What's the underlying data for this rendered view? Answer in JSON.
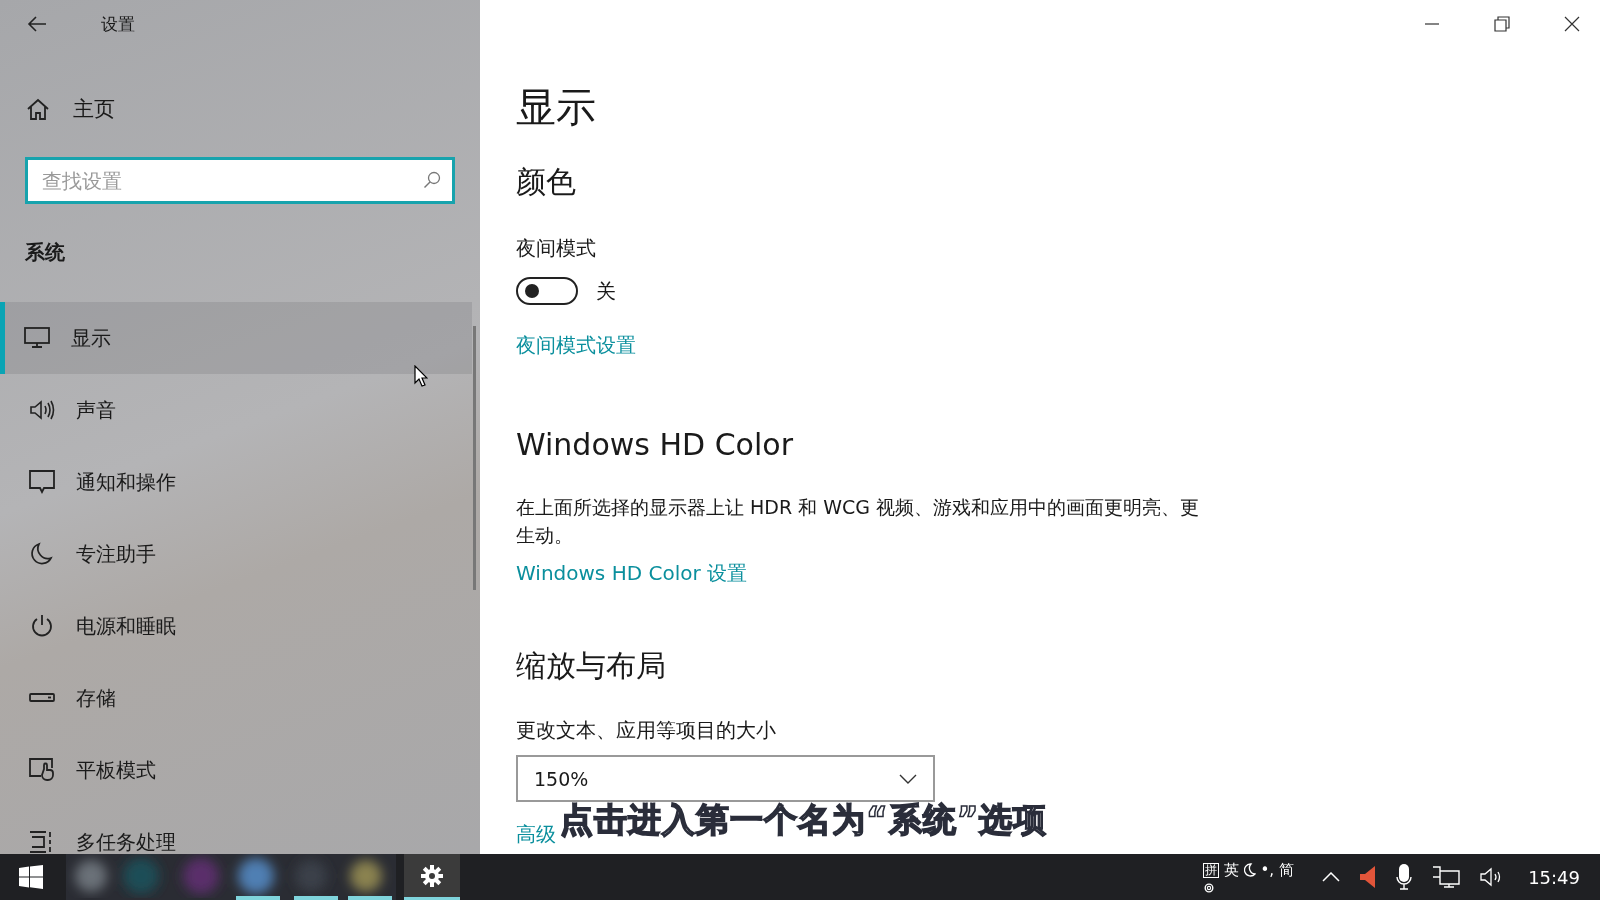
{
  "window": {
    "title": "设置"
  },
  "sidebar": {
    "home": "主页",
    "search": {
      "placeholder": "查找设置"
    },
    "section": "系统",
    "items": [
      {
        "label": "显示",
        "selected": true
      },
      {
        "label": "声音",
        "selected": false
      },
      {
        "label": "通知和操作",
        "selected": false
      },
      {
        "label": "专注助手",
        "selected": false
      },
      {
        "label": "电源和睡眠",
        "selected": false
      },
      {
        "label": "存储",
        "selected": false
      },
      {
        "label": "平板模式",
        "selected": false
      },
      {
        "label": "多任务处理",
        "selected": false
      }
    ]
  },
  "content": {
    "title": "显示",
    "color_section": {
      "heading": "颜色",
      "night_light": {
        "label": "夜间模式",
        "on": false,
        "state_text": "关"
      },
      "link": "夜间模式设置"
    },
    "hd_section": {
      "heading": "Windows HD Color",
      "description": "在上面所选择的显示器上让 HDR 和 WCG 视频、游戏和应用中的画面更明亮、更生动。",
      "link": "Windows HD Color 设置"
    },
    "scale_section": {
      "heading": "缩放与布局",
      "label": "更改文本、应用等项目的大小",
      "dropdown": {
        "value": "150%"
      },
      "link": "高级"
    }
  },
  "caption": "点击进入第一个名为“系统”选项",
  "taskbar": {
    "ime": {
      "layout": "拼",
      "mode": "英",
      "punct": "•,",
      "script": "简"
    },
    "time": "15:49"
  }
}
